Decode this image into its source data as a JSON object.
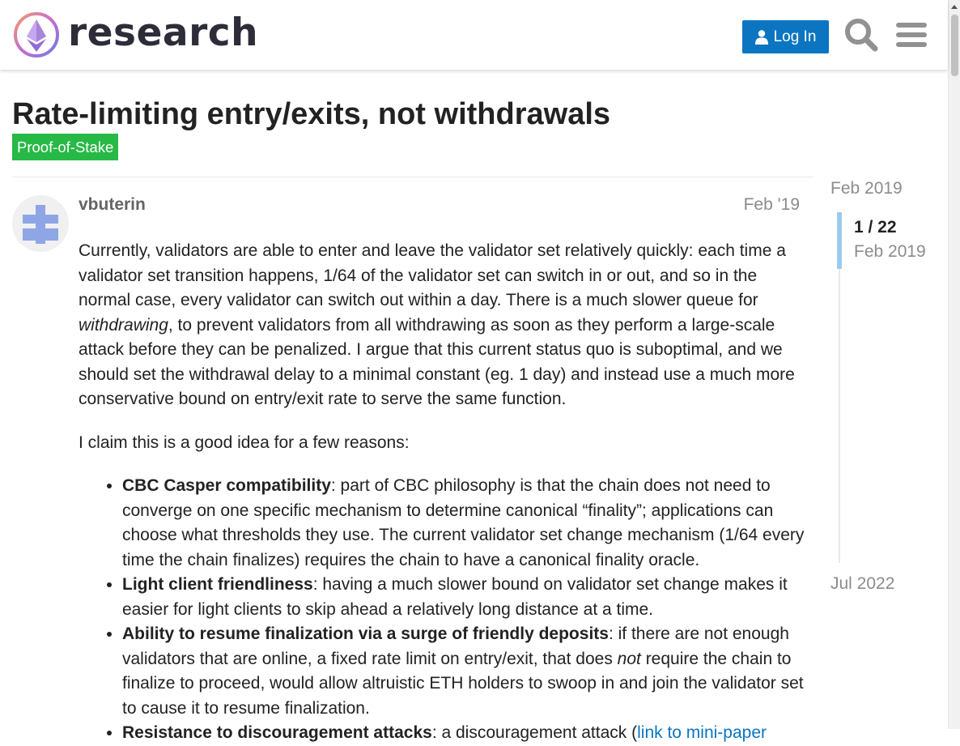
{
  "header": {
    "site_name": "research",
    "login_label": "Log In"
  },
  "topic": {
    "title": "Rate-limiting entry/exits, not withdrawals",
    "category": "Proof-of-Stake"
  },
  "post": {
    "username": "vbuterin",
    "date": "Feb '19",
    "intro": {
      "t1": "Currently, validators are able to enter and leave the validator set relatively quickly: each time a validator set transition happens, 1/64 of the validator set can switch in or out, and so in the normal case, every validator can switch out within a day. There is a much slower queue for ",
      "t2": "withdrawing",
      "t3": ", to prevent validators from all withdrawing as soon as they perform a large-scale attack before they can be penalized. I argue that this current status quo is suboptimal, and we should set the withdrawal delay to a minimal constant (eg. 1 day) and instead use a much more conservative bound on entry/exit rate to serve the same function."
    },
    "reasons_intro": "I claim this is a good idea for a few reasons:",
    "reasons": [
      {
        "title": "CBC Casper compatibility",
        "text": ": part of CBC philosophy is that the chain does not need to converge on one specific mechanism to determine canonical “finality”; applications can choose what thresholds they use. The current validator set change mechanism (1/64 every time the chain finalizes) requires the chain to have a canonical finality oracle."
      },
      {
        "title": "Light client friendliness",
        "text": ": having a much slower bound on validator set change makes it easier for light clients to skip ahead a relatively long distance at a time."
      },
      {
        "title": "Ability to resume finalization via a surge of friendly deposits",
        "t1": ": if there are not enough validators that are online, a fixed rate limit on entry/exit, that does ",
        "em": "not",
        "t2": " require the chain to finalize to proceed, would allow altruistic ETH holders to swoop in and join the validator set to cause it to resume finalization."
      },
      {
        "title": "Resistance to discouragement attacks",
        "text": ": a discouragement attack (",
        "link": "link to mini-paper"
      }
    ]
  },
  "timeline": {
    "start": "Feb 2019",
    "count": "1 / 22",
    "current_date": "Feb 2019",
    "end": "Jul 2022"
  },
  "colors": {
    "accent": "#0b75c1",
    "category": "#27b946",
    "timeline_handle": "#9ecaed",
    "avatar": "#8fa6e6"
  }
}
